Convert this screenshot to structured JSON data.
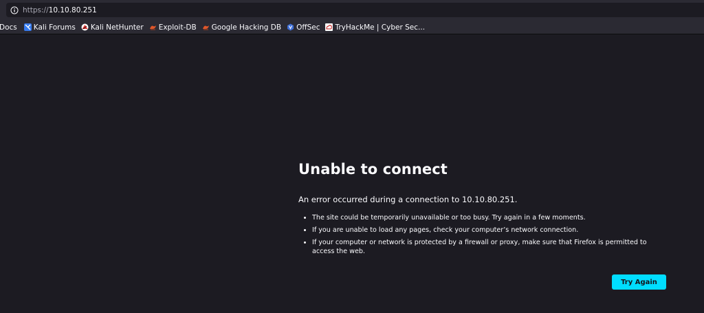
{
  "urlbar": {
    "scheme": "https://",
    "host": "10.10.80.251",
    "icon": "info-icon"
  },
  "bookmarks": [
    {
      "label": "Docs",
      "icon": "none"
    },
    {
      "label": "Kali Forums",
      "icon": "kali-forums-icon",
      "color": "#367bf0"
    },
    {
      "label": "Kali NetHunter",
      "icon": "kali-nethunter-icon",
      "color": "#e8322e"
    },
    {
      "label": "Exploit-DB",
      "icon": "exploit-db-icon",
      "color": "#e0572a"
    },
    {
      "label": "Google Hacking DB",
      "icon": "ghdb-icon",
      "color": "#e0572a"
    },
    {
      "label": "OffSec",
      "icon": "offsec-icon",
      "color": "#3f6fd8"
    },
    {
      "label": "TryHackMe | Cyber Sec...",
      "icon": "tryhackme-icon",
      "color": "#c11111"
    }
  ],
  "error": {
    "title": "Unable to connect",
    "description": "An error occurred during a connection to 10.10.80.251.",
    "items": [
      "The site could be temporarily unavailable or too busy. Try again in a few moments.",
      "If you are unable to load any pages, check your computer’s network connection.",
      "If your computer or network is protected by a firewall or proxy, make sure that Firefox is permitted to access the web."
    ],
    "button_label": "Try Again"
  },
  "colors": {
    "page_bg": "#1c1b22",
    "toolbar_bg": "#2b2a33",
    "accent_button": "#00ddff",
    "text": "#fbfbfe"
  }
}
